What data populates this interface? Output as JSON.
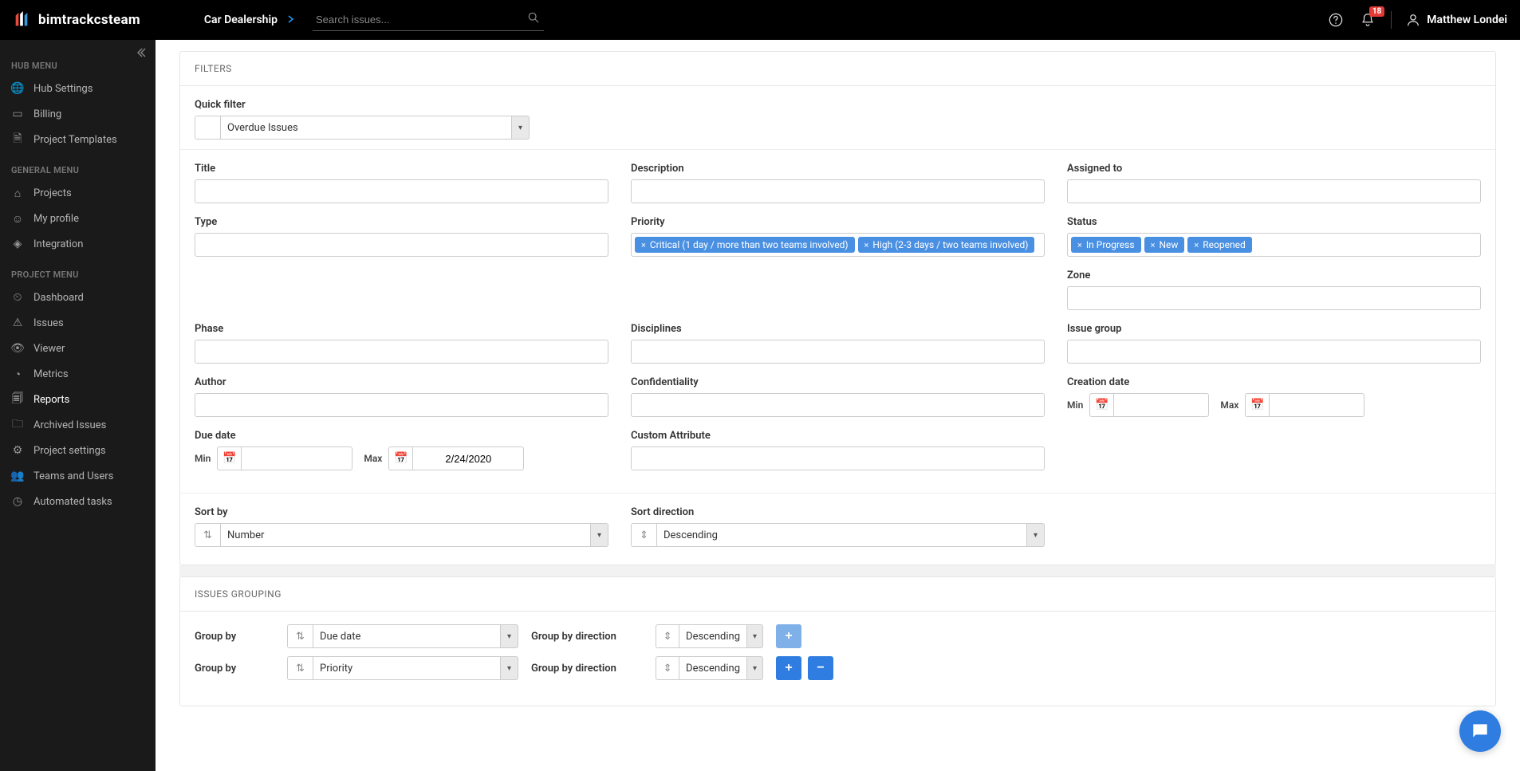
{
  "header": {
    "brand": "bimtrackcsteam",
    "project": "Car Dealership",
    "search_placeholder": "Search issues...",
    "notif_count": "18",
    "user": "Matthew Londei"
  },
  "sidebar": {
    "hub_header": "HUB MENU",
    "hub": [
      "Hub Settings",
      "Billing",
      "Project Templates"
    ],
    "general_header": "GENERAL MENU",
    "general": [
      "Projects",
      "My profile",
      "Integration"
    ],
    "project_header": "PROJECT MENU",
    "project": [
      "Dashboard",
      "Issues",
      "Viewer",
      "Metrics",
      "Reports",
      "Archived Issues",
      "Project settings",
      "Teams and Users",
      "Automated tasks"
    ]
  },
  "filters": {
    "title": "FILTERS",
    "quick_filter_label": "Quick filter",
    "quick_filter_value": "Overdue Issues",
    "labels": {
      "title": "Title",
      "description": "Description",
      "assigned": "Assigned to",
      "type": "Type",
      "priority": "Priority",
      "status": "Status",
      "zone": "Zone",
      "phase": "Phase",
      "disciplines": "Disciplines",
      "issue_group": "Issue group",
      "author": "Author",
      "confidentiality": "Confidentiality",
      "creation_date": "Creation date",
      "due_date": "Due date",
      "custom_attr": "Custom Attribute",
      "sort_by": "Sort by",
      "sort_direction": "Sort direction",
      "min": "Min",
      "max": "Max"
    },
    "priority_chips": [
      "Critical (1 day / more than two teams involved)",
      "High (2-3 days / two teams involved)"
    ],
    "status_chips": [
      "In Progress",
      "New",
      "Reopened"
    ],
    "due_date_max": "2/24/2020",
    "sort_by_value": "Number",
    "sort_direction_value": "Descending"
  },
  "grouping": {
    "title": "ISSUES GROUPING",
    "group_by_label": "Group by",
    "group_dir_label": "Group by direction",
    "rows": [
      {
        "field": "Due date",
        "direction": "Descending"
      },
      {
        "field": "Priority",
        "direction": "Descending"
      }
    ]
  }
}
